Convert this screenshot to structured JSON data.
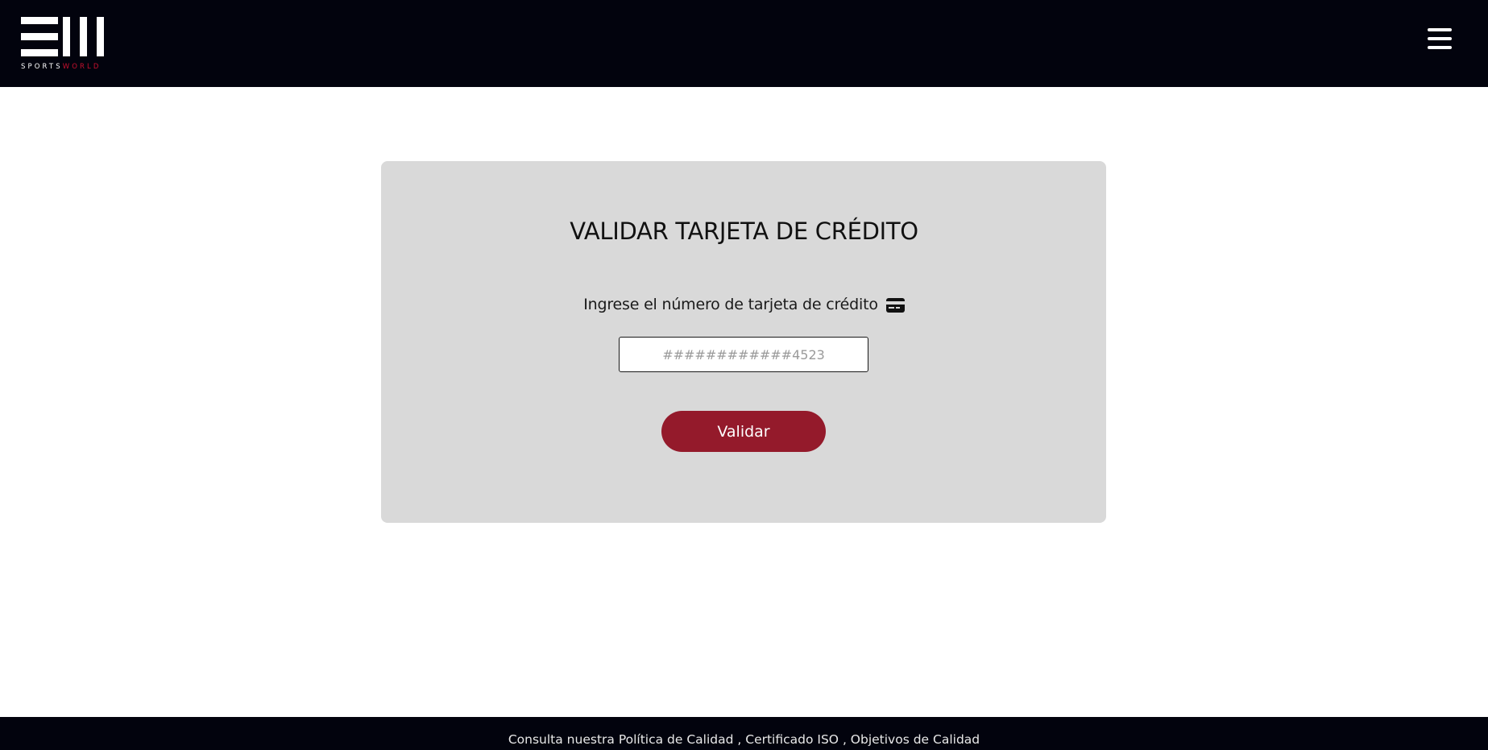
{
  "header": {
    "logo": {
      "text_part1": "SPORTS",
      "text_part2": "WORLD",
      "text_color": "#ffffff",
      "accent_color": "#c8102e"
    },
    "menu_icon": "hamburger-menu-icon",
    "background_color": "#02030d"
  },
  "card": {
    "title": "VALIDAR TARJETA DE CRÉDITO",
    "label": "Ingrese el número de tarjeta de crédito",
    "label_icon": "credit-card-icon",
    "input": {
      "value": "",
      "placeholder": "############4523"
    },
    "button_label": "Validar",
    "button_color": "#941a2b",
    "background_color": "#d9d9d9"
  },
  "footer": {
    "prefix": "Consulta nuestra ",
    "links": [
      {
        "label": "Política de Calidad"
      },
      {
        "label": "Certificado ISO"
      },
      {
        "label": "Objetivos de Calidad"
      }
    ],
    "separator": " , "
  }
}
